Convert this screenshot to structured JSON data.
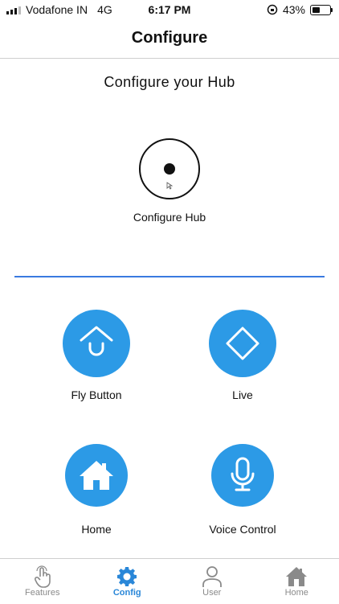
{
  "status": {
    "carrier": "Vodafone IN",
    "network": "4G",
    "time": "6:17 PM",
    "battery": "43%"
  },
  "header": {
    "title": "Configure"
  },
  "main": {
    "subtitle": "Configure your Hub",
    "hub_label": "Configure Hub"
  },
  "tiles": [
    {
      "label": "Fly Button",
      "icon": "fly-button-icon"
    },
    {
      "label": "Live",
      "icon": "diamond-icon"
    },
    {
      "label": "Home",
      "icon": "house-icon"
    },
    {
      "label": "Voice Control",
      "icon": "microphone-icon"
    }
  ],
  "tabs": [
    {
      "label": "Features",
      "icon": "touch-icon"
    },
    {
      "label": "Config",
      "icon": "gear-icon",
      "active": true
    },
    {
      "label": "User",
      "icon": "user-icon"
    },
    {
      "label": "Home",
      "icon": "house-icon"
    }
  ],
  "colors": {
    "accent": "#2c9ae6",
    "tab_active": "#2a87d8",
    "divider": "#3a7ae0"
  }
}
